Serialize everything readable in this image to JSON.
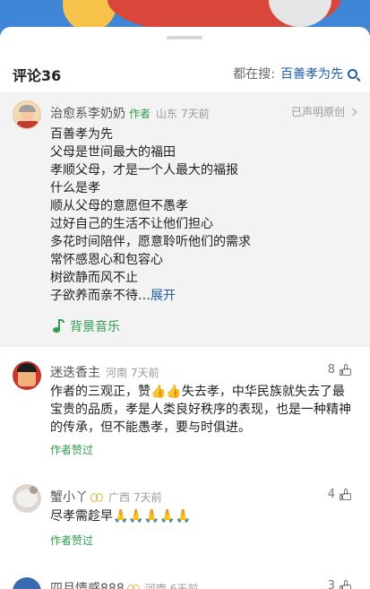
{
  "header": {
    "comment_count_label": "评论36",
    "searching_label": "都在搜:",
    "search_term": "百善孝为先"
  },
  "featured_comment": {
    "username": "治愈系李奶奶",
    "author_badge": "作者",
    "location": "山东",
    "time": "7天前",
    "original_status": "已声明原创",
    "lines": [
      "百善孝为先",
      "父母是世间最大的福田",
      "孝顺父母，才是一个人最大的福报",
      "什么是孝",
      "顺从父母的意愿但不愚孝",
      "过好自己的生活不让他们担心",
      "多花时间陪伴，愿意聆听他们的需求",
      "常怀感恩心和包容心",
      "树欲静而风不止",
      "子欲养而亲不待…"
    ],
    "expand_label": "展开",
    "music_label": "背景音乐",
    "avatar_icon": "grandma-avatar"
  },
  "comments": [
    {
      "username": "迷迭香主",
      "location": "河南",
      "time": "7天前",
      "likes": "8",
      "text": "作者的三观正，赞👍👍失去孝，中华民族就失去了最宝贵的品质，孝是人类良好秩序的表现，也是一种精神的传承，但不能愚孝，要与时俱进。",
      "author_liked": "作者赞过"
    },
    {
      "username": "蟹小丫",
      "location": "广西",
      "time": "7天前",
      "likes": "4",
      "text": "尽孝需趁早🙏🙏🙏🙏🙏",
      "author_liked": "作者赞过"
    },
    {
      "username": "四月情感888",
      "location": "河南",
      "time": "6天前",
      "likes": "3"
    }
  ],
  "colors": {
    "accent_green": "#2e9b4d",
    "link_blue": "#1f5aa8",
    "featured_bg": "#f3f3f3"
  }
}
